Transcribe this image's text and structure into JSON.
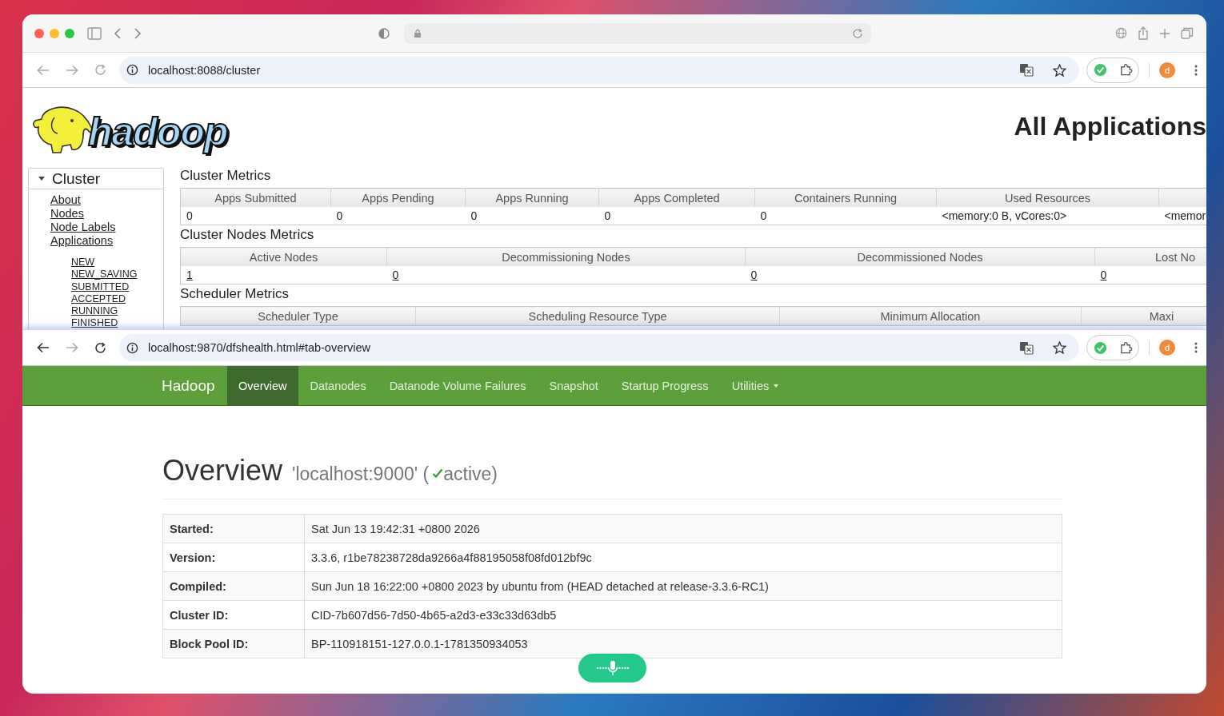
{
  "yarn_window": {
    "url": "localhost:8088/cluster",
    "back_enabled": false,
    "avatar": "d",
    "logo_text": "hadoop",
    "heading": "All Applications",
    "sidebar": {
      "title": "Cluster",
      "expanded": true,
      "links": [
        "About",
        "Nodes",
        "Node Labels",
        "Applications"
      ],
      "sublinks": [
        "NEW",
        "NEW_SAVING",
        "SUBMITTED",
        "ACCEPTED",
        "RUNNING",
        "FINISHED"
      ]
    },
    "sections": [
      {
        "title": "Cluster Metrics",
        "columns": [
          "Apps Submitted",
          "Apps Pending",
          "Apps Running",
          "Apps Completed",
          "Containers Running",
          "Used Resources"
        ],
        "rows": [
          [
            "0",
            "0",
            "0",
            "0",
            "0",
            "<memory:0 B, vCores:0>",
            "<memor"
          ]
        ]
      },
      {
        "title": "Cluster Nodes Metrics",
        "links": true,
        "columns": [
          "Active Nodes",
          "Decommissioning Nodes",
          "Decommissioned Nodes",
          "Lost No"
        ],
        "rows": [
          [
            "1",
            "0",
            "0",
            "0"
          ]
        ]
      },
      {
        "title": "Scheduler Metrics",
        "columns": [
          "Scheduler Type",
          "Scheduling Resource Type",
          "Minimum Allocation",
          "Maxi"
        ]
      }
    ]
  },
  "hdfs_window": {
    "url": "localhost:9870/dfshealth.html#tab-overview",
    "back_enabled": true,
    "avatar": "d",
    "brand": "Hadoop",
    "tabs": [
      {
        "label": "Overview",
        "selected": true,
        "has_menu": false
      },
      {
        "label": "Datanodes",
        "selected": false,
        "has_menu": false
      },
      {
        "label": "Datanode Volume Failures",
        "selected": false,
        "has_menu": false
      },
      {
        "label": "Snapshot",
        "selected": false,
        "has_menu": false
      },
      {
        "label": "Startup Progress",
        "selected": false,
        "has_menu": false
      },
      {
        "label": "Utilities",
        "selected": false,
        "has_menu": true
      }
    ],
    "title": "Overview",
    "host": "'localhost:9000' (",
    "status": "active)",
    "active": true,
    "info": [
      {
        "label": "Started:",
        "value": "Sat Jun 13 19:42:31 +0800 2026"
      },
      {
        "label": "Version:",
        "value": "3.3.6, r1be78238728da9266a4f88195058f08fd012bf9c"
      },
      {
        "label": "Compiled:",
        "value": "Sun Jun 18 16:22:00 +0800 2023 by ubuntu from (HEAD detached at release-3.3.6-RC1)"
      },
      {
        "label": "Cluster ID:",
        "value": "CID-7b607d56-7d50-4b65-a2d3-e33c33d63db5"
      },
      {
        "label": "Block Pool ID:",
        "value": "BP-110918151-127.0.0.1-1781350934053"
      }
    ]
  }
}
